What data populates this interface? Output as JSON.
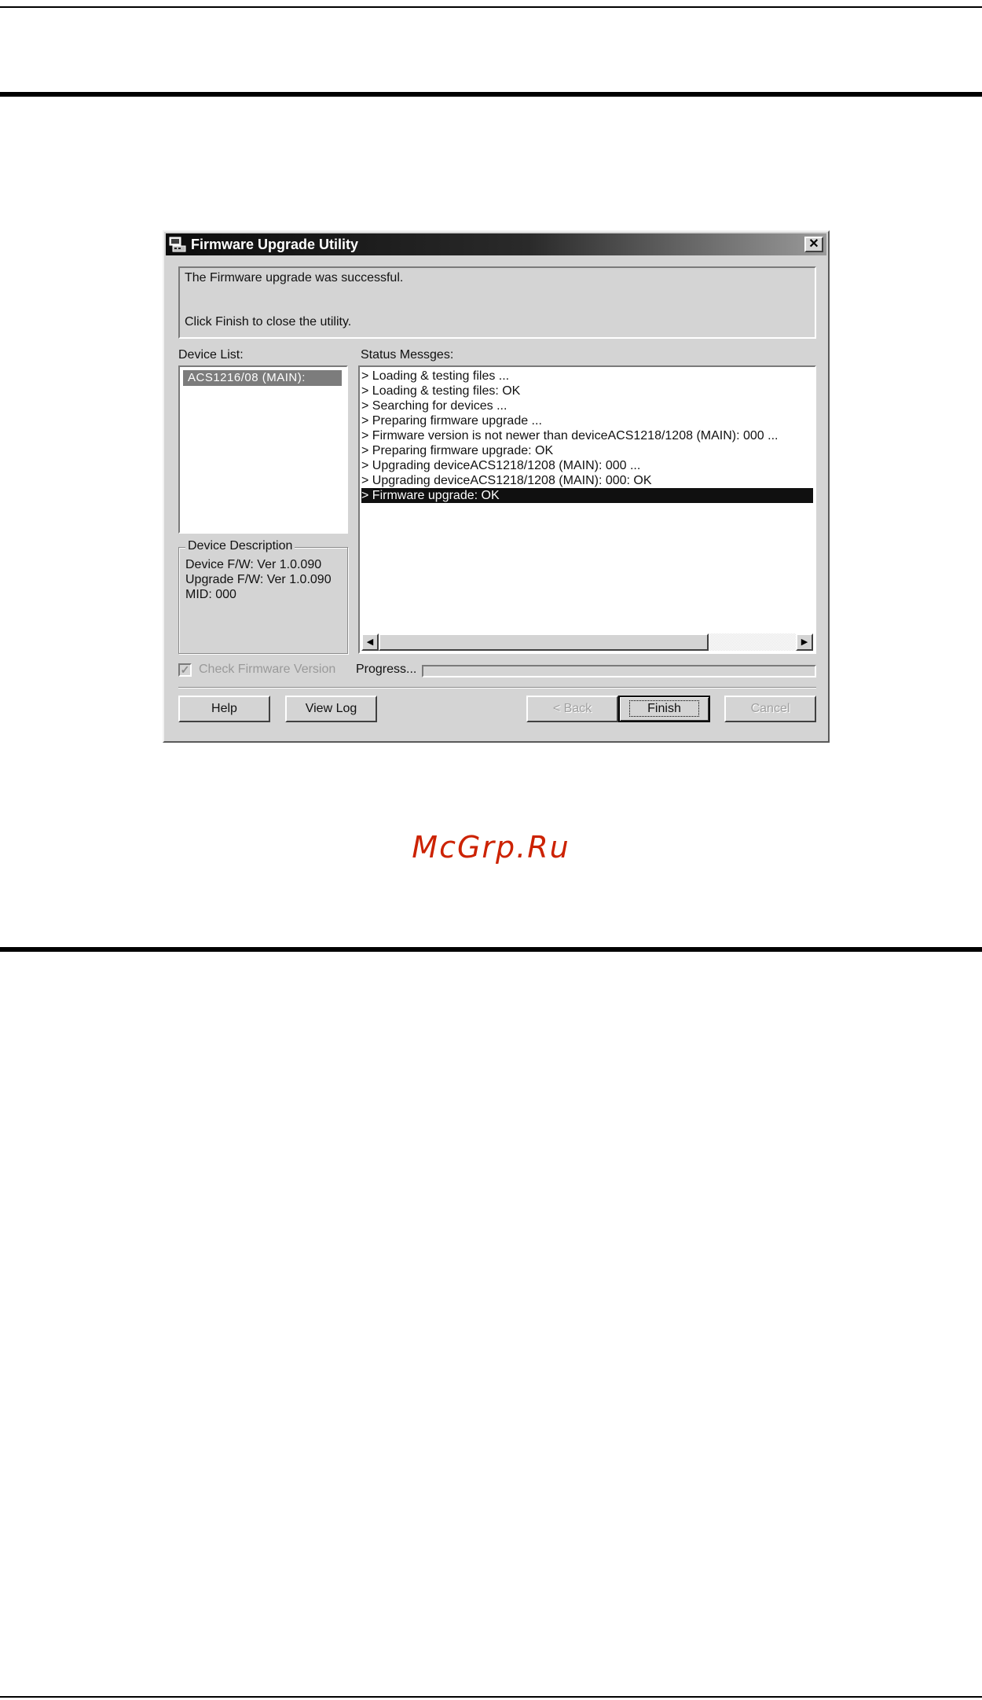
{
  "window": {
    "title": "Firmware Upgrade Utility",
    "close_glyph": "✕",
    "icon": "app-computer-icon"
  },
  "message": {
    "line1": "The Firmware upgrade was successful.",
    "line2": "Click Finish to close the utility."
  },
  "device_list": {
    "label": "Device List:",
    "items": [
      "ACS1216/08  (MAIN):"
    ]
  },
  "device_description": {
    "title": "Device Description",
    "device_fw": "Device F/W: Ver 1.0.090",
    "upgrade_fw": "Upgrade F/W: Ver 1.0.090",
    "mid": "MID: 000"
  },
  "status": {
    "label": "Status Messges:",
    "lines": [
      "> Loading & testing files ...",
      "> Loading & testing files: OK",
      "> Searching for devices ...",
      "> Preparing firmware upgrade ...",
      "> Firmware version is not newer than deviceACS1218/1208 (MAIN): 000 ...",
      "> Preparing firmware upgrade: OK",
      "> Upgrading deviceACS1218/1208 (MAIN): 000 ...",
      "> Upgrading deviceACS1218/1208 (MAIN): 000: OK",
      "> Firmware upgrade: OK"
    ],
    "selected_index": 8
  },
  "options": {
    "check_firmware_label": "Check Firmware Version",
    "check_firmware_checked": true,
    "check_glyph": "✓",
    "progress_label": "Progress...",
    "progress_value": 0
  },
  "buttons": {
    "help": "Help",
    "view_log": "View Log",
    "back": "< Back",
    "finish": "Finish",
    "cancel": "Cancel"
  },
  "scrollbar": {
    "left_glyph": "◀",
    "right_glyph": "▶"
  },
  "watermark": "McGrp.Ru"
}
